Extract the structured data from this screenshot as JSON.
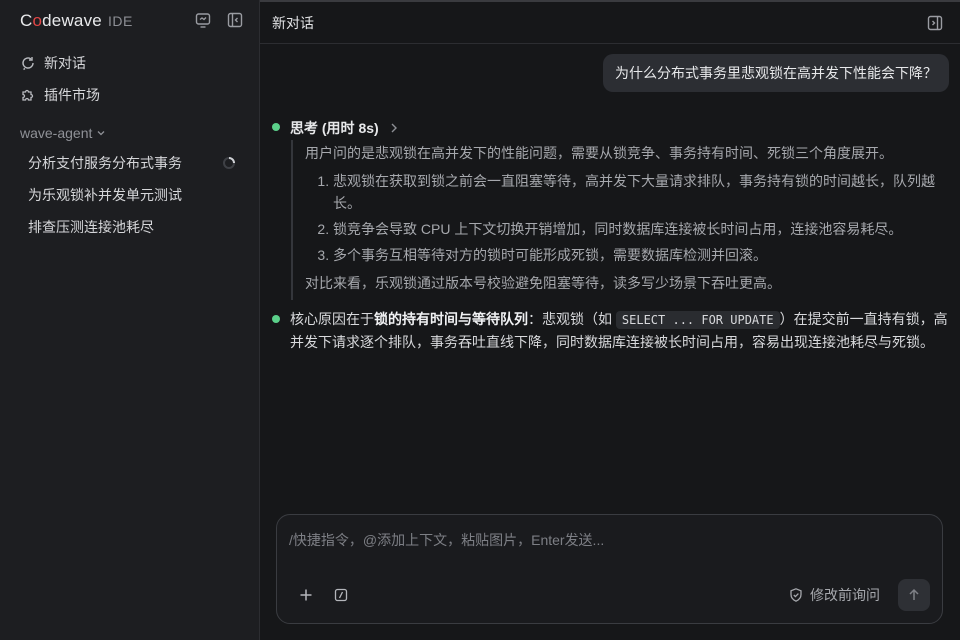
{
  "sidebar": {
    "brand": {
      "name_prefix": "C",
      "name_o": "o",
      "name_rest": "dewave",
      "suffix": "IDE"
    },
    "nav": [
      {
        "label": "新对话",
        "icon": "new-chat-icon"
      },
      {
        "label": "插件市场",
        "icon": "puzzle-icon"
      }
    ],
    "group": {
      "label": "wave-agent"
    },
    "sessions": [
      {
        "label": "分析支付服务分布式事务",
        "loading": true
      },
      {
        "label": "为乐观锁补并发单元测试"
      },
      {
        "label": "排查压测连接池耗尽"
      }
    ]
  },
  "main": {
    "title": "新对话",
    "user_message": "为什么分布式事务里悲观锁在高并发下性能会下降？",
    "thinking": {
      "title": "思考 (用时 8s)",
      "intro": "用户问的是悲观锁在高并发下的性能问题，需要从锁竞争、事务持有时间、死锁三个角度展开。",
      "points": [
        "悲观锁在获取到锁之前会一直阻塞等待，高并发下大量请求排队，事务持有锁的时间越长，队列越长。",
        "锁竞争会导致 CPU 上下文切换开销增加，同时数据库连接被长时间占用，连接池容易耗尽。",
        "多个事务互相等待对方的锁时可能形成死锁，需要数据库检测并回滚。"
      ],
      "outro": "对比来看，乐观锁通过版本号校验避免阻塞等待，读多写少场景下吞吐更高。"
    },
    "answer": {
      "prefix": "核心原因在于",
      "bold": "锁的持有时间与等待队列",
      "mid": "：悲观锁（如 ",
      "code": "SELECT ... FOR UPDATE",
      "suffix": "）在提交前一直持有锁，高并发下请求逐个排队，事务吞吐直线下降，同时数据库连接被长时间占用，容易出现连接池耗尽与死锁。"
    }
  },
  "composer": {
    "placeholder": "/快捷指令，@添加上下文，粘贴图片，Enter发送...",
    "ask_label": "修改前询问"
  },
  "colors": {
    "background": "#161719",
    "sidebar": "#1d1e21",
    "accent_dot": "#5bd08a",
    "brand_o": "#e04646"
  }
}
